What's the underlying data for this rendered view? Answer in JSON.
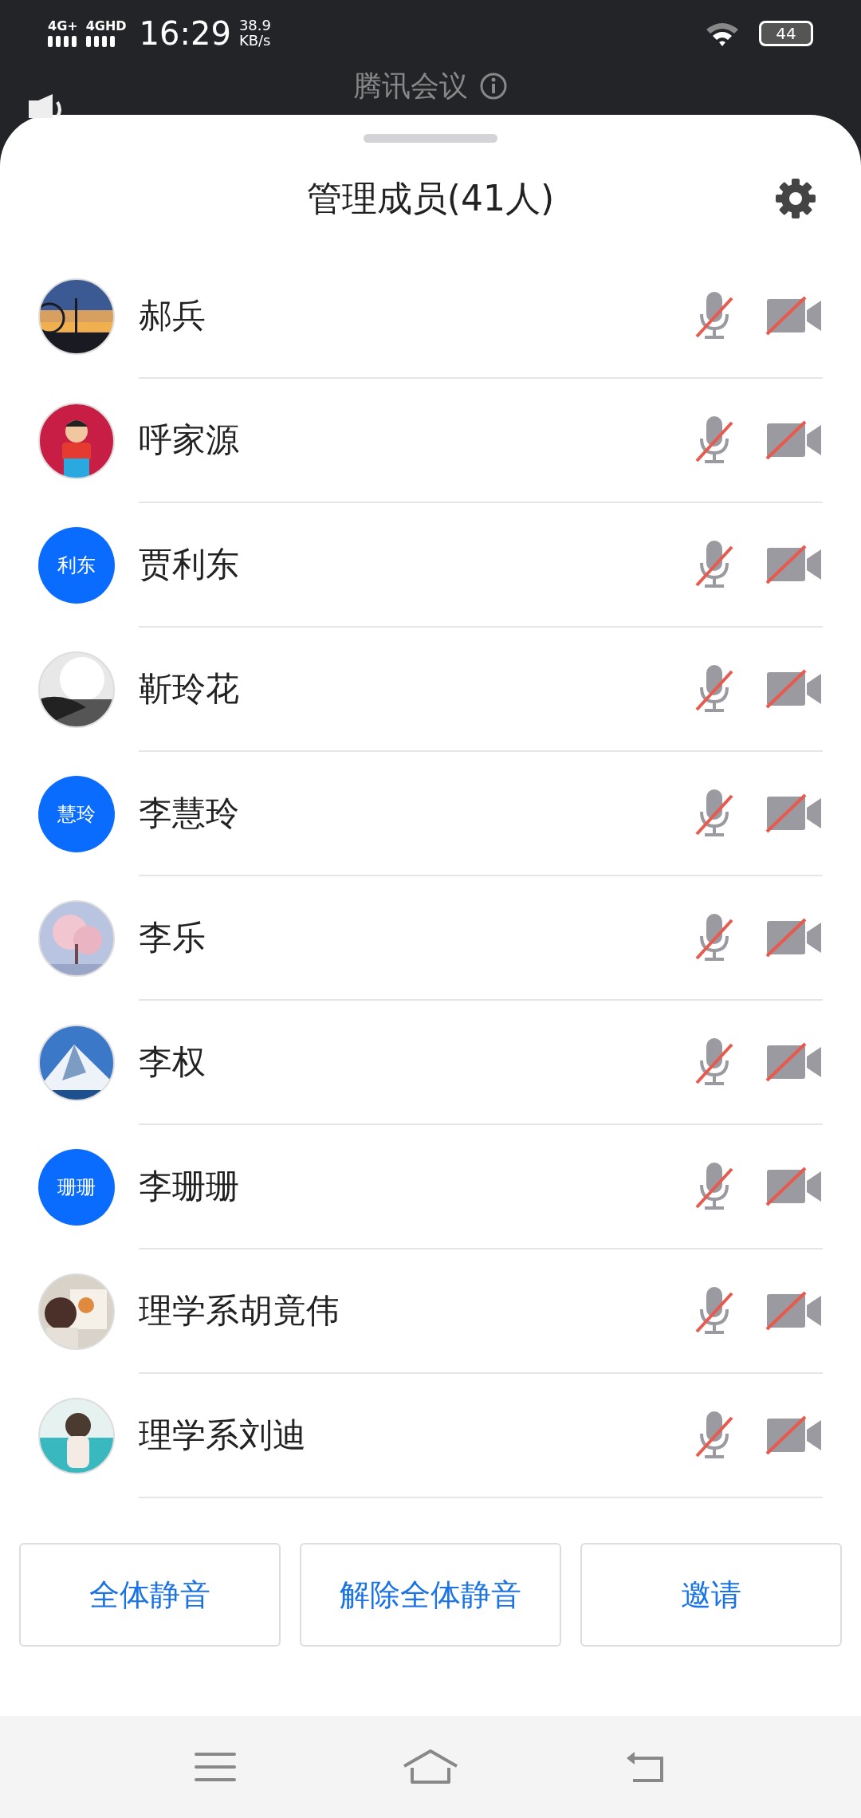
{
  "status_bar": {
    "network_1": "4G+",
    "network_2": "4GHD",
    "time": "16:29",
    "speed": "38.9",
    "speed_unit": "KB/s",
    "battery": "44"
  },
  "background_header": {
    "title": "腾讯会议"
  },
  "sheet": {
    "title": "管理成员(41人)"
  },
  "members": [
    {
      "name": "郝兵",
      "muted": true,
      "camera_off": true
    },
    {
      "name": "呼家源",
      "muted": true,
      "camera_off": true
    },
    {
      "name": "贾利东",
      "avatar": {
        "kind": "initials",
        "text": "利东"
      },
      "muted": true,
      "camera_off": true
    },
    {
      "name": "靳玲花",
      "muted": true,
      "camera_off": true
    },
    {
      "name": "李慧玲",
      "avatar": {
        "kind": "initials",
        "text": "慧玲"
      },
      "muted": true,
      "camera_off": true
    },
    {
      "name": "李乐",
      "muted": true,
      "camera_off": true
    },
    {
      "name": "李权",
      "muted": true,
      "camera_off": true
    },
    {
      "name": "李珊珊",
      "avatar": {
        "kind": "initials",
        "text": "珊珊"
      },
      "muted": true,
      "camera_off": true
    },
    {
      "name": "理学系胡竟伟",
      "muted": true,
      "camera_off": true
    },
    {
      "name": "理学系刘迪",
      "muted": true,
      "camera_off": true
    }
  ],
  "buttons": [
    "全体静音",
    "解除全体静音",
    "邀请"
  ]
}
